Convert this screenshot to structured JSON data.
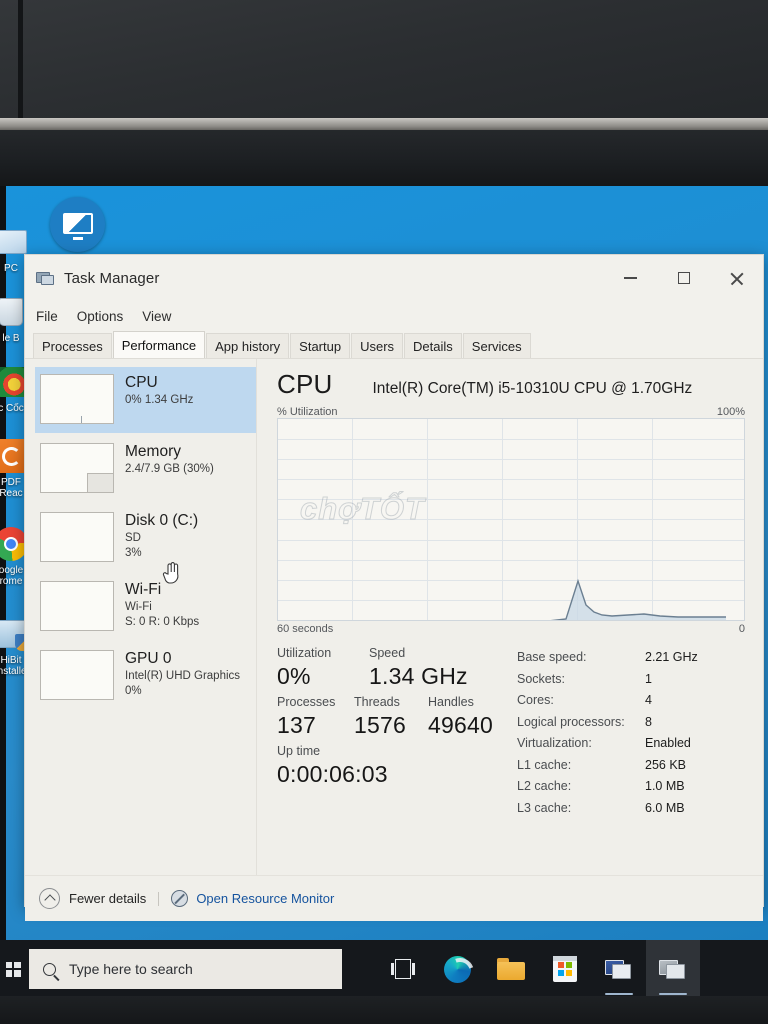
{
  "window": {
    "title": "Task Manager",
    "title_icon": "task-manager-icon",
    "controls": {
      "minimize": "Minimize",
      "maximize": "Maximize",
      "close": "Close"
    },
    "menu": [
      "File",
      "Options",
      "View"
    ],
    "tabs": [
      {
        "label": "Processes",
        "active": false
      },
      {
        "label": "Performance",
        "active": true
      },
      {
        "label": "App history",
        "active": false
      },
      {
        "label": "Startup",
        "active": false
      },
      {
        "label": "Users",
        "active": false
      },
      {
        "label": "Details",
        "active": false
      },
      {
        "label": "Services",
        "active": false
      }
    ]
  },
  "sidebar": {
    "items": [
      {
        "name": "CPU",
        "sub1": "0%  1.34 GHz",
        "sub2": "",
        "selected": true
      },
      {
        "name": "Memory",
        "sub1": "2.4/7.9 GB (30%)",
        "sub2": "",
        "selected": false
      },
      {
        "name": "Disk 0 (C:)",
        "sub1": "SD",
        "sub2": "3%",
        "selected": false
      },
      {
        "name": "Wi-Fi",
        "sub1": "Wi-Fi",
        "sub2": "S: 0 R: 0 Kbps",
        "selected": false
      },
      {
        "name": "GPU 0",
        "sub1": "Intel(R) UHD Graphics",
        "sub2": "0%",
        "selected": false
      }
    ]
  },
  "main": {
    "heading": "CPU",
    "cpu_name": "Intel(R) Core(TM) i5-10310U CPU @ 1.70GHz",
    "graph_top_left": "% Utilization",
    "graph_top_right": "100%",
    "graph_bottom_left": "60 seconds",
    "graph_bottom_right": "0",
    "watermark": "chợTỐT",
    "stats": [
      {
        "label": "Utilization",
        "value": "0%"
      },
      {
        "label": "Speed",
        "value": "1.34 GHz"
      },
      {
        "label": "Processes",
        "value": "137"
      },
      {
        "label": "Threads",
        "value": "1576"
      },
      {
        "label": "Handles",
        "value": "49640"
      },
      {
        "label": "Up time",
        "value": "0:00:06:03"
      }
    ],
    "specs": [
      {
        "key": "Base speed:",
        "value": "2.21 GHz"
      },
      {
        "key": "Sockets:",
        "value": "1"
      },
      {
        "key": "Cores:",
        "value": "4"
      },
      {
        "key": "Logical processors:",
        "value": "8"
      },
      {
        "key": "Virtualization:",
        "value": "Enabled"
      },
      {
        "key": "L1 cache:",
        "value": "256 KB"
      },
      {
        "key": "L2 cache:",
        "value": "1.0 MB"
      },
      {
        "key": "L3 cache:",
        "value": "6.0 MB"
      }
    ]
  },
  "footer": {
    "fewer_details": "Fewer details",
    "resource_monitor": "Open Resource Monitor"
  },
  "taskbar": {
    "search_placeholder": "Type here to search",
    "items": [
      {
        "name": "task-view",
        "active": false,
        "running": false
      },
      {
        "name": "microsoft-edge",
        "active": false,
        "running": false
      },
      {
        "name": "file-explorer",
        "active": false,
        "running": false
      },
      {
        "name": "microsoft-store",
        "active": false,
        "running": false
      },
      {
        "name": "task-manager-window-1",
        "active": false,
        "running": true
      },
      {
        "name": "task-manager-window-2",
        "active": true,
        "running": true
      }
    ]
  },
  "desktop": {
    "shortcut_icon": "monitor-shortcut-icon",
    "icons": [
      {
        "label": "PC"
      },
      {
        "label": "le B"
      },
      {
        "label": "c Cốc"
      },
      {
        "label": "PDF\nReac"
      },
      {
        "label": "oogle\nrome"
      },
      {
        "label": "HiBit\ninstalle"
      }
    ]
  },
  "chart_data": {
    "type": "area",
    "title": "% Utilization",
    "xlabel": "60 seconds",
    "ylabel": "% Utilization",
    "ylim": [
      0,
      100
    ],
    "xlim": [
      60,
      0
    ],
    "grid": true,
    "y_tick_labels": [
      "100%",
      "0"
    ],
    "x_tick_labels": [
      "60 seconds",
      "0"
    ],
    "series": [
      {
        "name": "CPU utilization",
        "x": [
          60,
          44,
          28,
          16,
          15.2,
          14.4,
          13.6,
          12.8,
          12,
          11.2,
          10.4,
          9.6,
          8.8,
          8,
          7,
          6,
          5,
          4,
          3,
          2,
          1,
          0
        ],
        "values": [
          0,
          0,
          0,
          0,
          2,
          9,
          20,
          24,
          18,
          11,
          7,
          5,
          4,
          3,
          3,
          3,
          3,
          3,
          2,
          2,
          2,
          2
        ]
      }
    ]
  }
}
